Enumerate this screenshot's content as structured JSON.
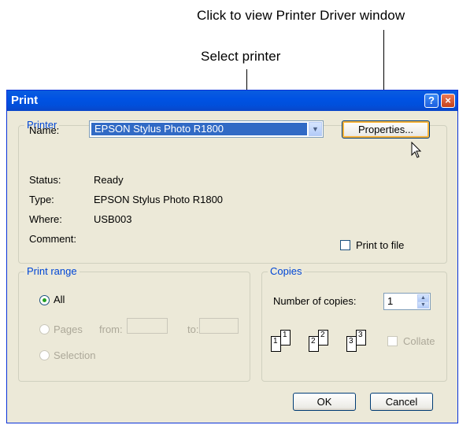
{
  "annotations": {
    "driver": "Click to view Printer Driver window",
    "select": "Select printer"
  },
  "dialog": {
    "title": "Print",
    "printer_group": "Printer",
    "name_label": "Name:",
    "name_value": "EPSON Stylus Photo R1800",
    "properties_label": "Properties...",
    "status_label": "Status:",
    "status_value": "Ready",
    "type_label": "Type:",
    "type_value": "EPSON Stylus Photo R1800",
    "where_label": "Where:",
    "where_value": "USB003",
    "comment_label": "Comment:",
    "print_to_file_label": "Print to file",
    "print_range_group": "Print range",
    "all_label": "All",
    "pages_label": "Pages",
    "from_label": "from:",
    "to_label": "to:",
    "selection_label": "Selection",
    "copies_group": "Copies",
    "num_copies_label": "Number of copies:",
    "num_copies_value": "1",
    "collate_label": "Collate",
    "collate_pages": [
      "1",
      "1",
      "2",
      "2",
      "3",
      "3"
    ],
    "ok_label": "OK",
    "cancel_label": "Cancel",
    "help_glyph": "?",
    "close_glyph": "×"
  }
}
